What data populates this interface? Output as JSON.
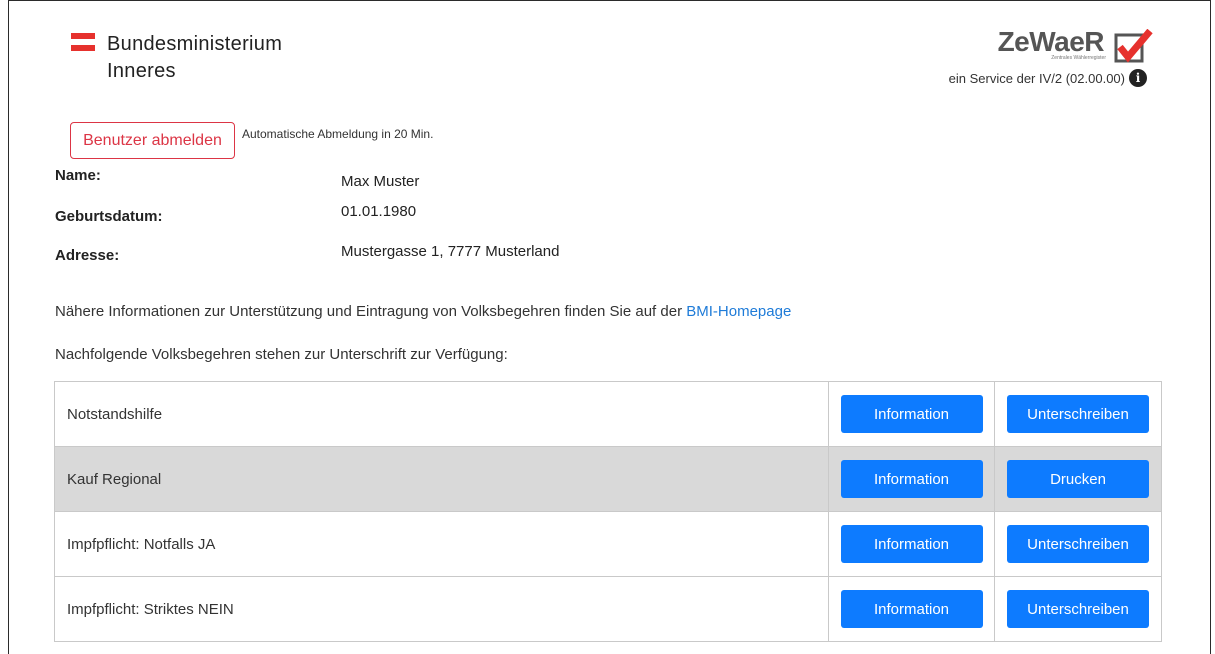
{
  "header": {
    "ministry_line1": "Bundesministerium",
    "ministry_line2": "Inneres",
    "app_name": "ZeWaeR",
    "app_subtitle": "Zentrales Wählerregister",
    "service_text": "ein Service der IV/2 (02.00.00)",
    "info_icon": "i"
  },
  "session": {
    "logout_label": "Benutzer abmelden",
    "auto_logout_text": "Automatische Abmeldung in 20 Min."
  },
  "user": {
    "name_label": "Name:",
    "name_value": "Max Muster",
    "birth_label": "Geburtsdatum:",
    "birth_value": "01.01.1980",
    "address_label": "Adresse:",
    "address_value": "Mustergasse 1, 7777 Musterland"
  },
  "info": {
    "text": "Nähere Informationen zur Unterstützung und Eintragung von Volksbegehren finden Sie auf der ",
    "link_label": "BMI-Homepage",
    "available_text": "Nachfolgende Volksbegehren stehen zur Unterschrift zur Verfügung:"
  },
  "petitions": [
    {
      "name": "Notstandshilfe",
      "info_label": "Information",
      "action_label": "Unterschreiben"
    },
    {
      "name": "Kauf Regional",
      "info_label": "Information",
      "action_label": "Drucken"
    },
    {
      "name": "Impfpflicht: Notfalls JA",
      "info_label": "Information",
      "action_label": "Unterschreiben"
    },
    {
      "name": "Impfpflicht: Striktes NEIN",
      "info_label": "Information",
      "action_label": "Unterschreiben"
    }
  ],
  "colors": {
    "primary_button": "#0d7bff",
    "logout_red": "#dc3545",
    "flag_red": "#e6312d",
    "link_blue": "#1e7bd8",
    "highlight_row": "#d9d9d9"
  }
}
